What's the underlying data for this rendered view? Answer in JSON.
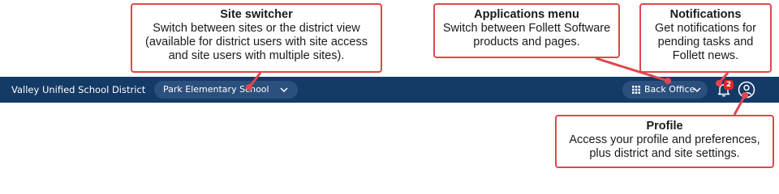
{
  "callouts": {
    "site_switcher": {
      "title": "Site switcher",
      "lines": [
        "Switch between sites or the district view",
        "(available for district users with site access",
        "and site users with multiple sites)."
      ]
    },
    "applications_menu": {
      "title": "Applications menu",
      "lines": [
        "Switch between Follett Software",
        "products and pages."
      ]
    },
    "notifications": {
      "title": "Notifications",
      "lines": [
        "Get notifications for",
        "pending tasks and",
        "Follett news."
      ]
    },
    "profile": {
      "title": "Profile",
      "lines": [
        "Access your profile and preferences,",
        "plus district and site settings."
      ]
    }
  },
  "topbar": {
    "district_name": "Valley Unified School District",
    "site_select_value": "Park Elementary School",
    "apps_label": "Back Office",
    "notification_count": "2"
  },
  "colors": {
    "topbar": "#143a66",
    "pill": "#2c507d",
    "callout_border": "#e0474c",
    "badge": "#e02424"
  },
  "icons": {
    "site_chevron": "chevron-down-icon",
    "apps_grid": "grid-icon",
    "apps_chevron": "chevron-down-icon",
    "notifications": "bell-icon",
    "profile": "user-circle-icon"
  }
}
